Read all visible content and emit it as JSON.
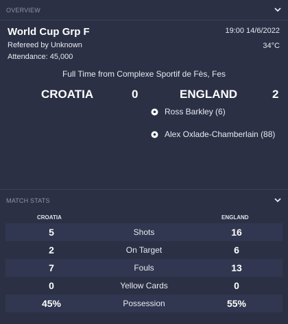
{
  "overview": {
    "section_title": "OVERVIEW",
    "competition": "World Cup Grp F",
    "referee": "Refereed by Unknown",
    "attendance": "Attendance: 45,000",
    "datetime": "19:00 14/6/2022",
    "temperature": "34°C",
    "venue": "Full Time from Complexe Sportif de Fès, Fes",
    "home_team": "CROATIA",
    "home_score": "0",
    "away_team": "ENGLAND",
    "away_score": "2",
    "scorers": [
      {
        "name": "Ross Barkley (6)",
        "icon": "football-icon"
      },
      {
        "name": "Alex Oxlade-Chamberlain (88)",
        "icon": "football-icon"
      }
    ]
  },
  "match_stats": {
    "section_title": "MATCH STATS",
    "home_header": "CROATIA",
    "away_header": "ENGLAND",
    "rows": [
      {
        "label": "Shots",
        "home": "5",
        "away": "16"
      },
      {
        "label": "On Target",
        "home": "2",
        "away": "6"
      },
      {
        "label": "Fouls",
        "home": "7",
        "away": "13"
      },
      {
        "label": "Yellow Cards",
        "home": "0",
        "away": "0"
      },
      {
        "label": "Possession",
        "home": "45%",
        "away": "55%"
      }
    ]
  },
  "colors": {
    "background": "#2b3044",
    "row_alt": "#313750",
    "muted_text": "#8f95ab"
  }
}
